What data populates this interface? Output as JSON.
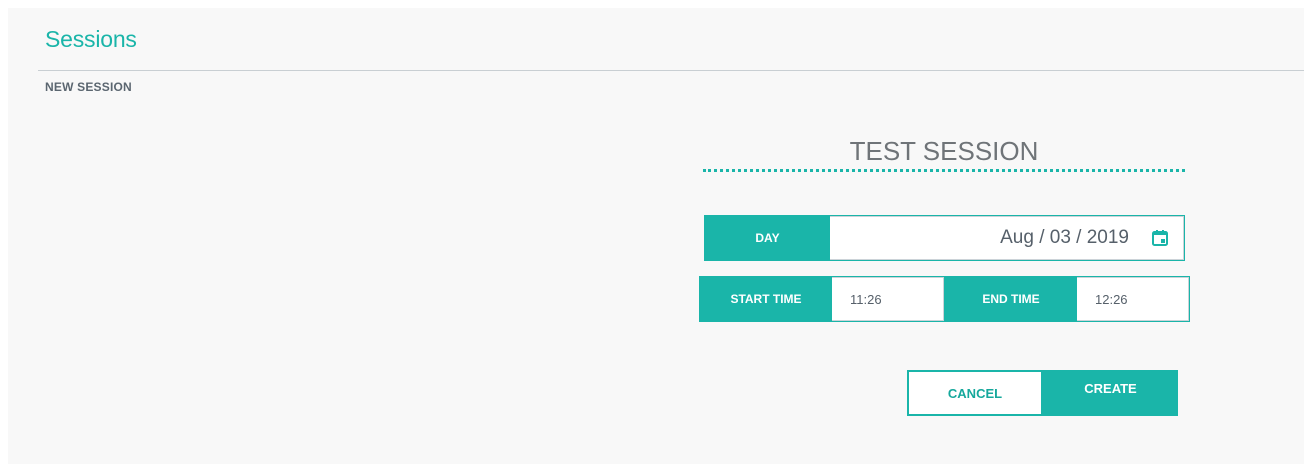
{
  "header": {
    "title": "Sessions",
    "section": "NEW SESSION"
  },
  "form": {
    "session_name": "TEST SESSION",
    "day": {
      "label": "DAY",
      "value": "Aug / 03 / 2019",
      "icon": "calendar-icon"
    },
    "start_time": {
      "label": "START TIME",
      "value": "11:26"
    },
    "end_time": {
      "label": "END TIME",
      "value": "12:26"
    },
    "cancel_label": "CANCEL",
    "create_label": "CREATE"
  },
  "colors": {
    "accent": "#1ab5a9",
    "background": "#f8f8f8",
    "text": "#56606a"
  }
}
